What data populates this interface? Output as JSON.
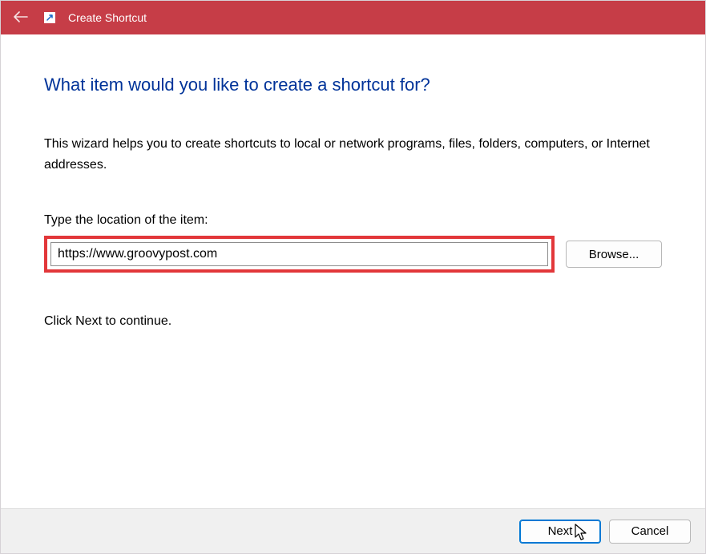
{
  "titlebar": {
    "title": "Create Shortcut"
  },
  "content": {
    "heading": "What item would you like to create a shortcut for?",
    "description": "This wizard helps you to create shortcuts to local or network programs, files, folders, computers, or Internet addresses.",
    "field_label": "Type the location of the item:",
    "location_value": "https://www.groovypost.com",
    "browse_label": "Browse...",
    "continue_text": "Click Next to continue."
  },
  "footer": {
    "next_label": "Next",
    "cancel_label": "Cancel"
  }
}
